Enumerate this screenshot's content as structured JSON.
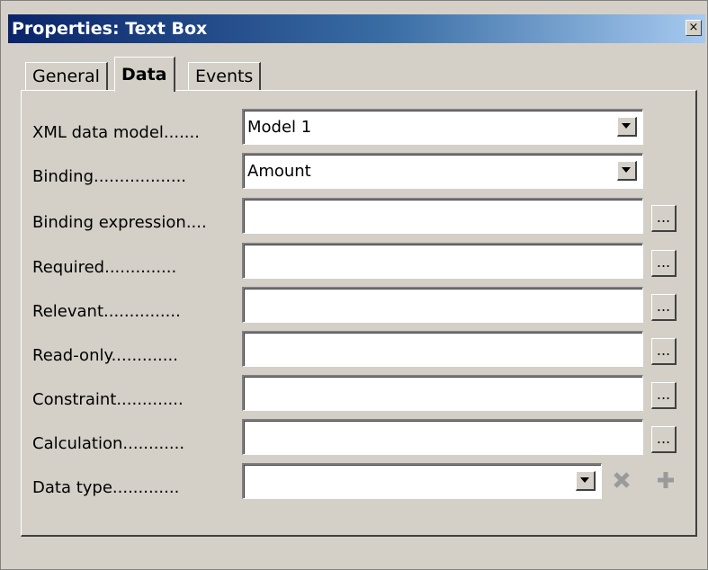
{
  "window": {
    "title": "Properties: Text Box",
    "close_glyph": "×"
  },
  "tabs": [
    {
      "label": "General",
      "active": false
    },
    {
      "label": "Data",
      "active": true
    },
    {
      "label": "Events",
      "active": false
    }
  ],
  "rows": [
    {
      "label": "XML data model.......",
      "value": "Model 1",
      "control": "dropdown"
    },
    {
      "label": "Binding..................",
      "value": "Amount",
      "control": "dropdown"
    },
    {
      "label": "Binding expression....",
      "value": "",
      "control": "text",
      "button": "..."
    },
    {
      "label": "Required..............",
      "value": "",
      "control": "text",
      "button": "..."
    },
    {
      "label": "Relevant...............",
      "value": "",
      "control": "text",
      "button": "..."
    },
    {
      "label": "Read-only.............",
      "value": "",
      "control": "text",
      "button": "..."
    },
    {
      "label": "Constraint.............",
      "value": "",
      "control": "text",
      "button": "..."
    },
    {
      "label": "Calculation............",
      "value": "",
      "control": "text",
      "button": "..."
    },
    {
      "label": "Data type.............",
      "value": "",
      "control": "dropdown"
    }
  ],
  "data_type_buttons": {
    "remove_icon": "x-icon",
    "add_icon": "plus-icon"
  },
  "colors": {
    "titlebar_start": "#0a246a",
    "titlebar_end": "#a6caf0",
    "face": "#d4d0c8"
  }
}
